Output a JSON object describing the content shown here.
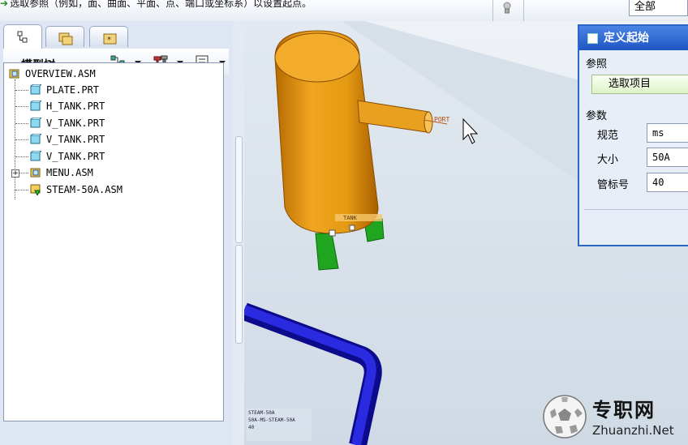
{
  "message": {
    "text": "选取参照（例如，面、曲面、平面、点、端口或坐标系）以设置起点。"
  },
  "filter": {
    "value": "全部"
  },
  "left_panel": {
    "title": "模型树",
    "tree": [
      {
        "label": "OVERVIEW.ASM",
        "type": "assembly"
      },
      {
        "label": "PLATE.PRT",
        "type": "part"
      },
      {
        "label": "H_TANK.PRT",
        "type": "part"
      },
      {
        "label": "V_TANK.PRT",
        "type": "part"
      },
      {
        "label": "V_TANK.PRT",
        "type": "part"
      },
      {
        "label": "V_TANK.PRT",
        "type": "part"
      },
      {
        "label": "MENU.ASM",
        "type": "assembly",
        "expandable": true
      },
      {
        "label": "STEAM-50A.ASM",
        "type": "assembly-active"
      }
    ]
  },
  "dialog": {
    "title": "定义起始",
    "section_reference": "参照",
    "select_button": "选取项目",
    "section_params": "参数",
    "params": [
      {
        "label": "规范",
        "value": "ms"
      },
      {
        "label": "大小",
        "value": "50A"
      },
      {
        "label": "管标号",
        "value": "40"
      }
    ]
  },
  "viewport_labels": {
    "port": "PORT",
    "tank_label": "TANK",
    "status_lines": [
      "STEAM-50A",
      "50A-MS-STEAM-50A",
      "40",
      ""
    ]
  },
  "watermark": {
    "chinese": "专职网",
    "url": "Zhuanzhi.Net"
  },
  "colors": {
    "tank": "#e59a13",
    "legs": "#1fa51f",
    "pipe": "#1010c0",
    "floor": "#d4dee8",
    "dialog_border": "#2b66c9"
  }
}
